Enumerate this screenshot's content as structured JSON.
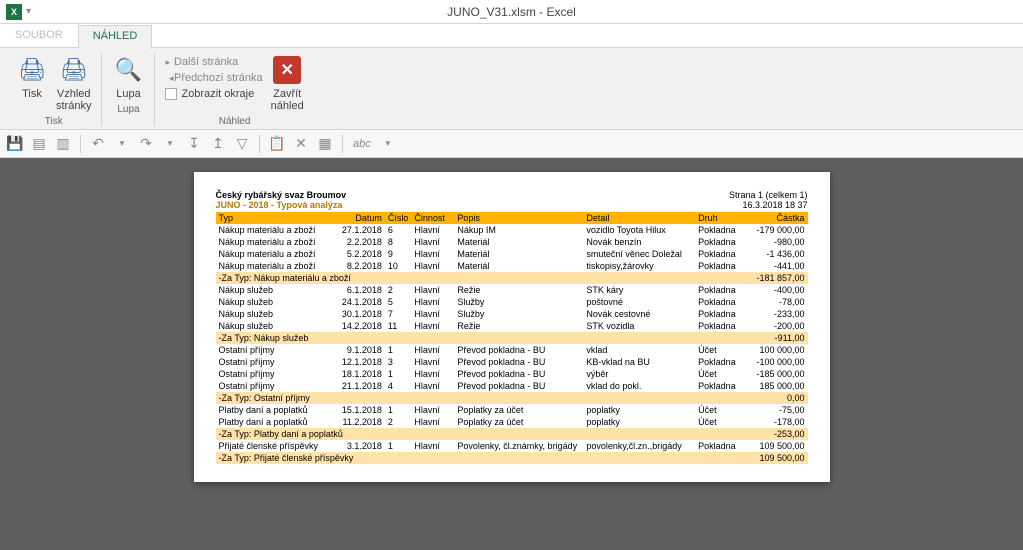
{
  "window": {
    "title": "JUNO_V31.xlsm - Excel"
  },
  "tabs": {
    "file": "SOUBOR",
    "preview": "NÁHLED"
  },
  "ribbon": {
    "print": "Tisk",
    "page_layout": "Vzhled\nstránky",
    "zoom": "Lupa",
    "next_page": "Další stránka",
    "prev_page": "Předchozí stránka",
    "show_margins": "Zobrazit okraje",
    "close_preview": "Zavřít\nnáhled",
    "grp_print": "Tisk",
    "grp_zoom": "Lupa",
    "grp_preview": "Náhled"
  },
  "qat": {
    "abc": "abc"
  },
  "report": {
    "org": "Český rybářský svaz Broumov",
    "subtitle": "JUNO - 2018 - Typová analýza",
    "page_info": "Strana 1 (celkem 1)",
    "timestamp": "16.3.2018 18 37",
    "columns": {
      "typ": "Typ",
      "datum": "Datum",
      "cislo": "Číslo",
      "cinnost": "Činnost",
      "popis": "Popis",
      "detail": "Detail",
      "druh": "Druh",
      "castka": "Částka"
    },
    "groups": [
      {
        "rows": [
          {
            "typ": "Nákup materiálu a zboží",
            "datum": "27.1.2018",
            "cislo": "6",
            "cinnost": "Hlavní",
            "popis": "Nákup IM",
            "detail": "vozidlo Toyota Hilux",
            "druh": "Pokladna",
            "castka": "-179 000,00"
          },
          {
            "typ": "Nákup materiálu a zboží",
            "datum": "2.2.2018",
            "cislo": "8",
            "cinnost": "Hlavní",
            "popis": "Materiál",
            "detail": "Novák benzín",
            "druh": "Pokladna",
            "castka": "-980,00"
          },
          {
            "typ": "Nákup materiálu a zboží",
            "datum": "5.2.2018",
            "cislo": "9",
            "cinnost": "Hlavní",
            "popis": "Materiál",
            "detail": "smuteční věnec Doležal",
            "druh": "Pokladna",
            "castka": "-1 436,00"
          },
          {
            "typ": "Nákup materiálu a zboží",
            "datum": "8.2.2018",
            "cislo": "10",
            "cinnost": "Hlavní",
            "popis": "Materiál",
            "detail": "tiskopisy,žárovky",
            "druh": "Pokladna",
            "castka": "-441,00"
          }
        ],
        "subtotal": {
          "label": "-Za Typ: Nákup materiálu a zboží",
          "value": "-181 857,00"
        }
      },
      {
        "rows": [
          {
            "typ": "Nákup služeb",
            "datum": "6.1.2018",
            "cislo": "2",
            "cinnost": "Hlavní",
            "popis": "Režie",
            "detail": "STK káry",
            "druh": "Pokladna",
            "castka": "-400,00"
          },
          {
            "typ": "Nákup služeb",
            "datum": "24.1.2018",
            "cislo": "5",
            "cinnost": "Hlavní",
            "popis": "Služby",
            "detail": "poštovné",
            "druh": "Pokladna",
            "castka": "-78,00"
          },
          {
            "typ": "Nákup služeb",
            "datum": "30.1.2018",
            "cislo": "7",
            "cinnost": "Hlavní",
            "popis": "Služby",
            "detail": "Novák cestovné",
            "druh": "Pokladna",
            "castka": "-233,00"
          },
          {
            "typ": "Nákup služeb",
            "datum": "14.2.2018",
            "cislo": "11",
            "cinnost": "Hlavní",
            "popis": "Režie",
            "detail": "STK vozidla",
            "druh": "Pokladna",
            "castka": "-200,00"
          }
        ],
        "subtotal": {
          "label": "-Za Typ: Nákup služeb",
          "value": "-911,00"
        }
      },
      {
        "rows": [
          {
            "typ": "Ostatní příjmy",
            "datum": "9.1.2018",
            "cislo": "1",
            "cinnost": "Hlavní",
            "popis": "Převod pokladna - BU",
            "detail": "vklad",
            "druh": "Účet",
            "castka": "100 000,00"
          },
          {
            "typ": "Ostatní příjmy",
            "datum": "12.1.2018",
            "cislo": "3",
            "cinnost": "Hlavní",
            "popis": "Převod pokladna - BU",
            "detail": "KB-vklad na BU",
            "druh": "Pokladna",
            "castka": "-100 000,00"
          },
          {
            "typ": "Ostatní příjmy",
            "datum": "18.1.2018",
            "cislo": "1",
            "cinnost": "Hlavní",
            "popis": "Převod pokladna - BU",
            "detail": "výběr",
            "druh": "Účet",
            "castka": "-185 000,00"
          },
          {
            "typ": "Ostatní příjmy",
            "datum": "21.1.2018",
            "cislo": "4",
            "cinnost": "Hlavní",
            "popis": "Převod pokladna - BU",
            "detail": "vklad do pokl.",
            "druh": "Pokladna",
            "castka": "185 000,00"
          }
        ],
        "subtotal": {
          "label": "-Za Typ: Ostatní příjmy",
          "value": "0,00"
        }
      },
      {
        "rows": [
          {
            "typ": "Platby daní a poplatků",
            "datum": "15.1.2018",
            "cislo": "1",
            "cinnost": "Hlavní",
            "popis": "Poplatky za účet",
            "detail": "poplatky",
            "druh": "Účet",
            "castka": "-75,00"
          },
          {
            "typ": "Platby daní a poplatků",
            "datum": "11.2.2018",
            "cislo": "2",
            "cinnost": "Hlavní",
            "popis": "Poplatky za účet",
            "detail": "poplatky",
            "druh": "Účet",
            "castka": "-178,00"
          }
        ],
        "subtotal": {
          "label": "-Za Typ: Platby daní a poplatků",
          "value": "-253,00"
        }
      },
      {
        "rows": [
          {
            "typ": "Přijaté členské příspěvky",
            "datum": "3.1.2018",
            "cislo": "1",
            "cinnost": "Hlavní",
            "popis": "Povolenky, čl.známky, brigády",
            "detail": "povolenky,čl.zn.,brigády",
            "druh": "Pokladna",
            "castka": "109 500,00"
          }
        ],
        "subtotal": {
          "label": "-Za Typ: Přijaté členské příspěvky",
          "value": "109 500,00"
        }
      }
    ]
  }
}
